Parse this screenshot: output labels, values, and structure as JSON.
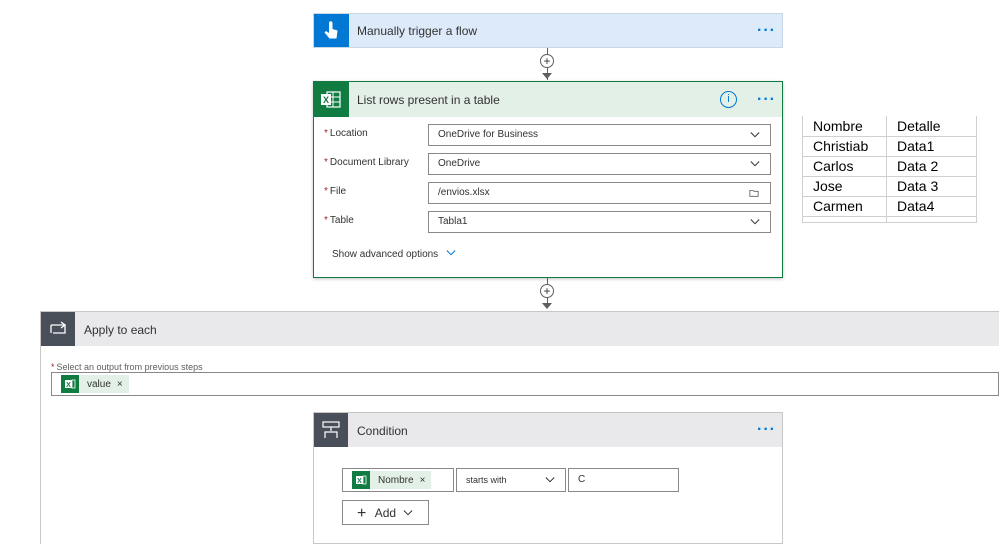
{
  "trigger": {
    "title": "Manually trigger a flow"
  },
  "list_rows": {
    "title": "List rows present in a table",
    "fields": [
      {
        "label": "Location",
        "value": "OneDrive for Business"
      },
      {
        "label": "Document Library",
        "value": "OneDrive"
      },
      {
        "label": "File",
        "value": "/envios.xlsx"
      },
      {
        "label": "Table",
        "value": "Tabla1"
      }
    ],
    "advanced_label": "Show advanced options"
  },
  "apply_each": {
    "title": "Apply to each",
    "select_label": "Select an output from previous steps",
    "token": "value"
  },
  "condition": {
    "title": "Condition",
    "left_token": "Nombre",
    "operator": "starts with",
    "right_value": "C",
    "add_label": "Add"
  },
  "sheet": {
    "header": [
      "Nombre",
      "Detalle"
    ],
    "rows": [
      [
        "Christiab",
        "Data1"
      ],
      [
        "Carlos",
        "Data 2"
      ],
      [
        "Jose",
        "Data 3"
      ],
      [
        "Carmen",
        "Data4"
      ]
    ]
  },
  "colors": {
    "accent": "#0078d4",
    "excel_green": "#107c41",
    "trigger_bg": "#ddeeff",
    "list_bg": "#e3f0e8",
    "gray_header": "#e7e7ea"
  }
}
